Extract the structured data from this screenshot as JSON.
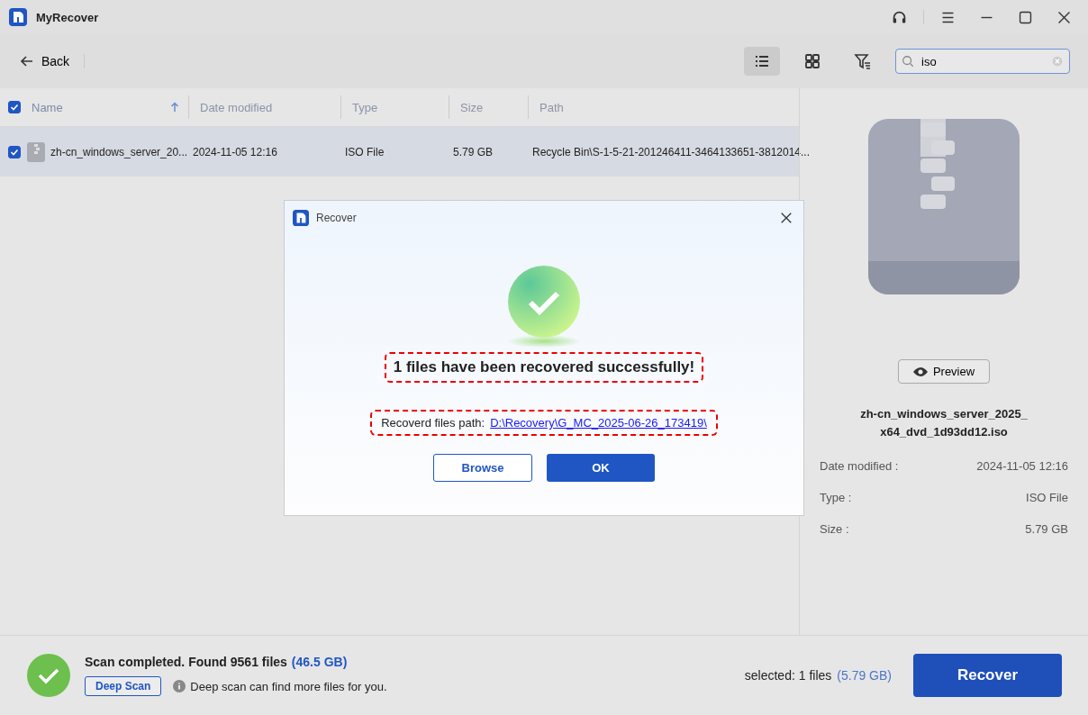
{
  "window": {
    "title": "MyRecover"
  },
  "toolbar": {
    "back": "Back",
    "view_modes": [
      {
        "kind": "list",
        "selected": true
      },
      {
        "kind": "grid",
        "selected": false
      }
    ],
    "search": {
      "value": "iso"
    }
  },
  "table": {
    "all_checked": true,
    "columns": [
      {
        "label": "Name",
        "sorted": true
      },
      {
        "label": "Date modified",
        "sorted": false
      },
      {
        "label": "Type",
        "sorted": false
      },
      {
        "label": "Size",
        "sorted": false
      },
      {
        "label": "Path",
        "sorted": false
      }
    ],
    "rows": [
      {
        "checked": true,
        "selected": true,
        "name": "zh-cn_windows_server_20...",
        "date": "2024-11-05 12:16",
        "type": "ISO File",
        "size": "5.79 GB",
        "path": "Recycle Bin\\S-1-5-21-201246411-3464133651-3812014..."
      }
    ]
  },
  "details": {
    "preview": "Preview",
    "filename": "zh-cn_windows_server_2025_x64_dvd_1d93dd12.iso",
    "fields": [
      {
        "label": "Date modified :",
        "value": "2024-11-05 12:16"
      },
      {
        "label": "Type :",
        "value": "ISO File"
      },
      {
        "label": "Size :",
        "value": "5.79 GB"
      }
    ]
  },
  "dialog": {
    "title": "Recover",
    "message": {
      "text": "1 files have been recovered successfully!",
      "annotated": true
    },
    "path": {
      "label": "Recoverd files path:",
      "link": "D:\\Recovery\\G_MC_2025-06-26_173419\\",
      "annotated": true
    },
    "buttons": [
      "Browse",
      "OK"
    ]
  },
  "status": {
    "message": "Scan completed. Found 9561 files",
    "total": "(46.5 GB)",
    "deep_scan": "Deep Scan",
    "hint": "Deep scan can find more files for you.",
    "selected": "selected: 1 files",
    "selected_size": "(5.79 GB)",
    "recover": "Recover"
  }
}
